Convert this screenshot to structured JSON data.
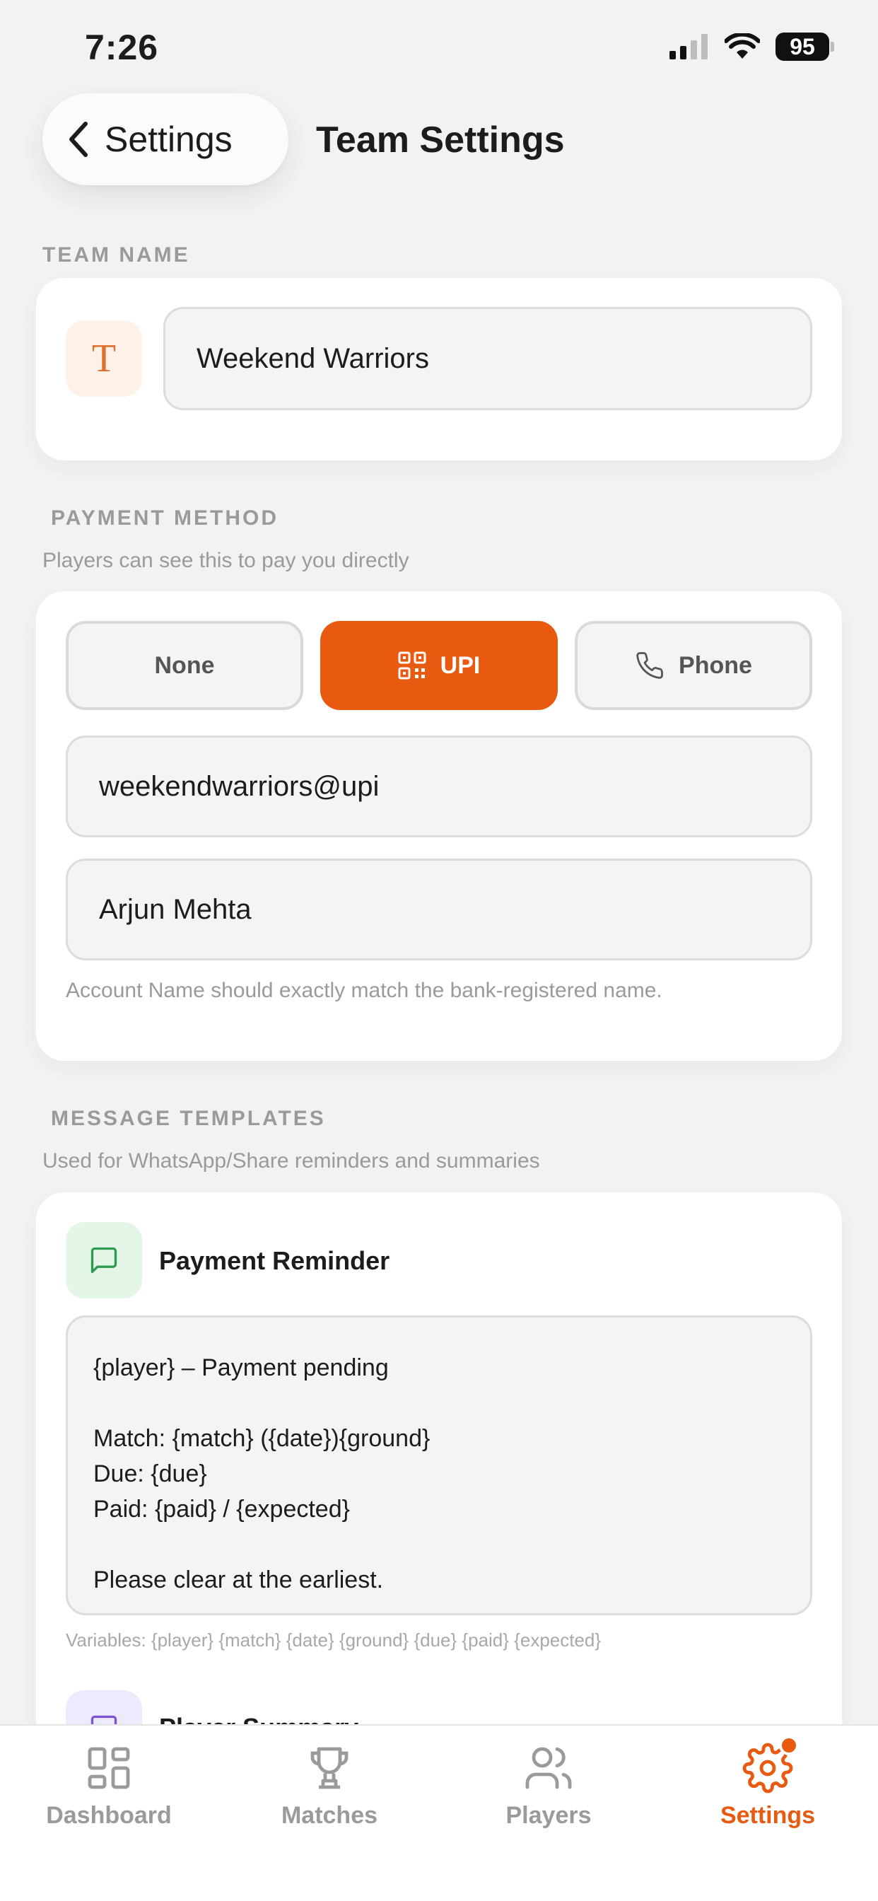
{
  "status_bar": {
    "time": "7:26",
    "battery": "95"
  },
  "header": {
    "back_label": "Settings",
    "title": "Team Settings"
  },
  "team_name": {
    "section_label": "TEAM NAME",
    "avatar_letter": "T",
    "value": "Weekend Warriors"
  },
  "payment_method": {
    "section_label": "PAYMENT METHOD",
    "subtitle": "Players can see this to pay you directly",
    "options": [
      "None",
      "UPI",
      "Phone"
    ],
    "selected": "UPI",
    "upi_id": "weekendwarriors@upi",
    "account_name": "Arjun Mehta",
    "hint": "Account Name should exactly match the bank-registered name."
  },
  "message_templates": {
    "section_label": "MESSAGE TEMPLATES",
    "subtitle": "Used for WhatsApp/Share reminders and summaries",
    "payment_reminder": {
      "title": "Payment Reminder",
      "body": "{player} – Payment pending\n\nMatch: {match} ({date}){ground}\nDue: {due}\nPaid: {paid} / {expected}\n\nPlease clear at the earliest.",
      "variables": "Variables: {player} {match} {date} {ground} {due} {paid} {expected}"
    },
    "player_summary": {
      "title": "Player Summary"
    }
  },
  "tabs": [
    {
      "label": "Dashboard",
      "icon": "grid-icon",
      "active": false
    },
    {
      "label": "Matches",
      "icon": "trophy-icon",
      "active": false
    },
    {
      "label": "Players",
      "icon": "users-icon",
      "active": false
    },
    {
      "label": "Settings",
      "icon": "gear-icon",
      "active": true
    }
  ],
  "colors": {
    "accent": "#e85a10",
    "background": "#f2f2f1",
    "muted_text": "#9a9a98",
    "green_tint": "#e3f6e8",
    "purple_tint": "#eeeafd"
  }
}
